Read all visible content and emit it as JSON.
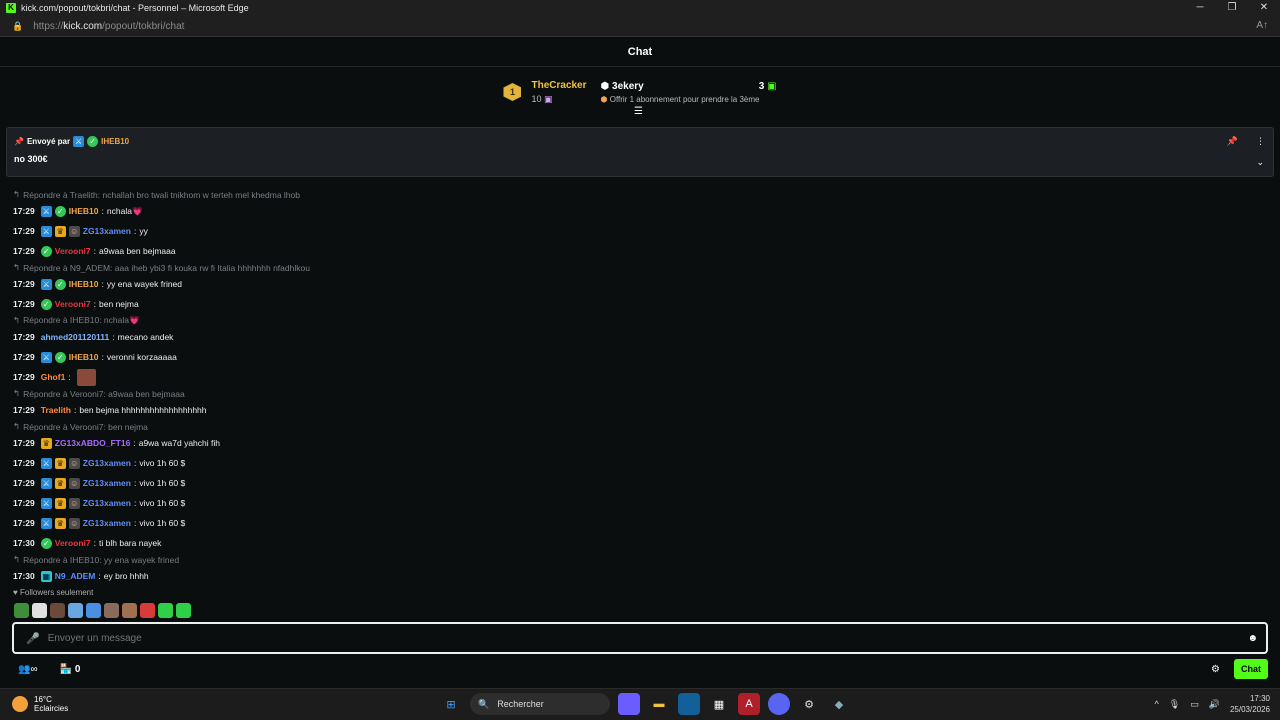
{
  "window": {
    "title": "kick.com/popout/tokbri/chat - Personnel – Microsoft Edge",
    "url_prefix": "https://",
    "url_host": "kick.com",
    "url_path": "/popout/tokbri/chat",
    "reader_icon": "A↑"
  },
  "chat": {
    "title": "Chat"
  },
  "leaderboard": {
    "first": {
      "rank": "1",
      "name": "TheCracker",
      "subs": "10"
    },
    "second": {
      "name": "3ekery",
      "count": "3",
      "hint": "Offrir 1 abonnement pour prendre la 3ème"
    }
  },
  "pinned": {
    "label": "Envoyé par",
    "user": "IHEB10",
    "message": "no 300€"
  },
  "messages": [
    {
      "reply": "Répondre à Traelith: nchallah bro twali tnikhom w terteh mel khedma lhob",
      "time": "17:29",
      "badges": [
        "pin",
        "ver"
      ],
      "user": "IHEB10",
      "color": "#f0a64a",
      "text": "nchala💗"
    },
    {
      "time": "17:29",
      "badges": [
        "pin",
        "crown",
        "og"
      ],
      "user": "ZG13xamen",
      "color": "#5f8cff",
      "text": "yy"
    },
    {
      "time": "17:29",
      "badges": [
        "ver"
      ],
      "user": "Verooni7",
      "color": "#e8353f",
      "text": "a9waa ben bejmaaa"
    },
    {
      "reply": "Répondre à N9_ADEM: aaa iheb ybi3 fi kouka rw fi Italia hhhhhhh nfadhlkou",
      "time": "17:29",
      "badges": [
        "pin",
        "ver"
      ],
      "user": "IHEB10",
      "color": "#f0a64a",
      "text": "yy ena wayek frined"
    },
    {
      "time": "17:29",
      "badges": [
        "ver"
      ],
      "user": "Verooni7",
      "color": "#e8353f",
      "text": "ben nejma"
    },
    {
      "reply": "Répondre à IHEB10: nchala💗",
      "time": "17:29",
      "badges": [],
      "user": "ahmed201120111",
      "color": "#7fb4ff",
      "text": "mecano andek"
    },
    {
      "time": "17:29",
      "badges": [
        "pin",
        "ver"
      ],
      "user": "IHEB10",
      "color": "#f0a64a",
      "text": "veronni korzaaaaa"
    },
    {
      "time": "17:29",
      "badges": [],
      "user": "Ghof1",
      "color": "#ff8a3d",
      "text": "",
      "emote": true
    },
    {
      "reply": "Répondre à Verooni7: a9waa ben bejmaaa",
      "time": "17:29",
      "badges": [],
      "user": "Traelith",
      "color": "#ff8a3d",
      "text": "ben bejma hhhhhhhhhhhhhhhhhh"
    },
    {
      "reply": "Répondre à Verooni7: ben nejma",
      "time": "17:29",
      "badges": [
        "crown"
      ],
      "user": "ZG13xABDO_FT16",
      "color": "#a86bff",
      "text": "a9wa wa7d yahchi fih"
    },
    {
      "time": "17:29",
      "badges": [
        "pin",
        "crown",
        "og"
      ],
      "user": "ZG13xamen",
      "color": "#5f8cff",
      "text": "vivo 1h 60 $"
    },
    {
      "time": "17:29",
      "badges": [
        "pin",
        "crown",
        "og"
      ],
      "user": "ZG13xamen",
      "color": "#5f8cff",
      "text": "vivo 1h 60 $"
    },
    {
      "time": "17:29",
      "badges": [
        "pin",
        "crown",
        "og"
      ],
      "user": "ZG13xamen",
      "color": "#5f8cff",
      "text": "vivo 1h 60 $"
    },
    {
      "time": "17:29",
      "badges": [
        "pin",
        "crown",
        "og"
      ],
      "user": "ZG13xamen",
      "color": "#5f8cff",
      "text": "vivo 1h 60 $"
    },
    {
      "time": "17:30",
      "badges": [
        "ver"
      ],
      "user": "Verooni7",
      "color": "#e8353f",
      "text": "ti blh bara nayek"
    },
    {
      "reply": "Répondre à IHEB10: yy ena wayek frined",
      "time": "17:30",
      "badges": [
        "gift"
      ],
      "user": "N9_ADEM",
      "color": "#5f8cff",
      "text": "ey bro hhhh"
    }
  ],
  "followers_label": "Followers seulement",
  "emote_colors": [
    "#3f8f3a",
    "#e0e0e0",
    "#6b4a3a",
    "#6aa7e0",
    "#4a8fe0",
    "#8a6a5a",
    "#a07050",
    "#d93a3a",
    "#2fcf4a",
    "#2fcf4a"
  ],
  "input": {
    "placeholder": "Envoyer un message"
  },
  "bottom": {
    "count": "0",
    "chat_button": "Chat"
  },
  "taskbar": {
    "temp": "16°C",
    "weather": "Eclaircies",
    "search": "Rechercher",
    "time": "17:30",
    "date": "25/03/2026"
  }
}
